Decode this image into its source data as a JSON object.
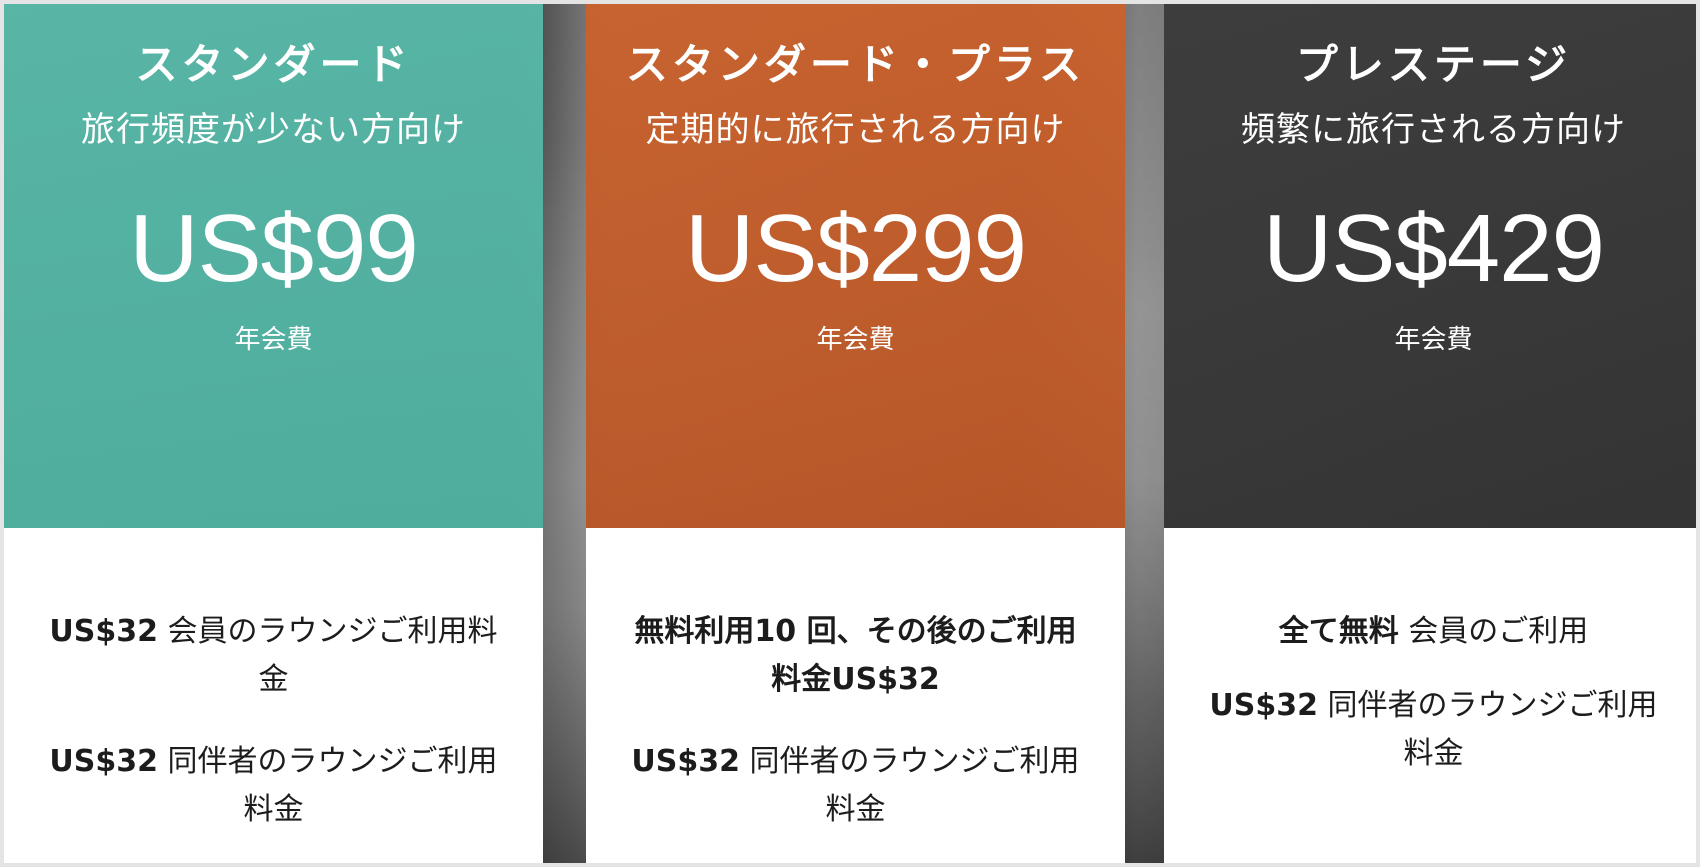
{
  "plans": [
    {
      "name": "スタンダード",
      "subtitle": "旅行頻度が少ない方向け",
      "price": "US$99",
      "period": "年会費",
      "color": "#55b5a5",
      "features": [
        {
          "bold": "US$32",
          "text": " 会員のラウンジご利用料金"
        },
        {
          "bold": "US$32",
          "text": " 同伴者のラウンジご利用料金"
        }
      ]
    },
    {
      "name": "スタンダード・プラス",
      "subtitle": "定期的に旅行される方向け",
      "price": "US$299",
      "period": "年会費",
      "color": "#c35c2a",
      "features": [
        {
          "bold": "無料利用10 回、その後のご利用料金US$32",
          "text": ""
        },
        {
          "bold": "US$32",
          "text": " 同伴者のラウンジご利用料金"
        }
      ]
    },
    {
      "name": "プレステージ",
      "subtitle": "頻繁に旅行される方向け",
      "price": "US$429",
      "period": "年会費",
      "color": "#3a3a3a",
      "features": [
        {
          "bold": "全て無料",
          "text": " 会員のご利用"
        },
        {
          "bold": "US$32",
          "text": " 同伴者のラウンジご利用料金"
        }
      ]
    }
  ]
}
